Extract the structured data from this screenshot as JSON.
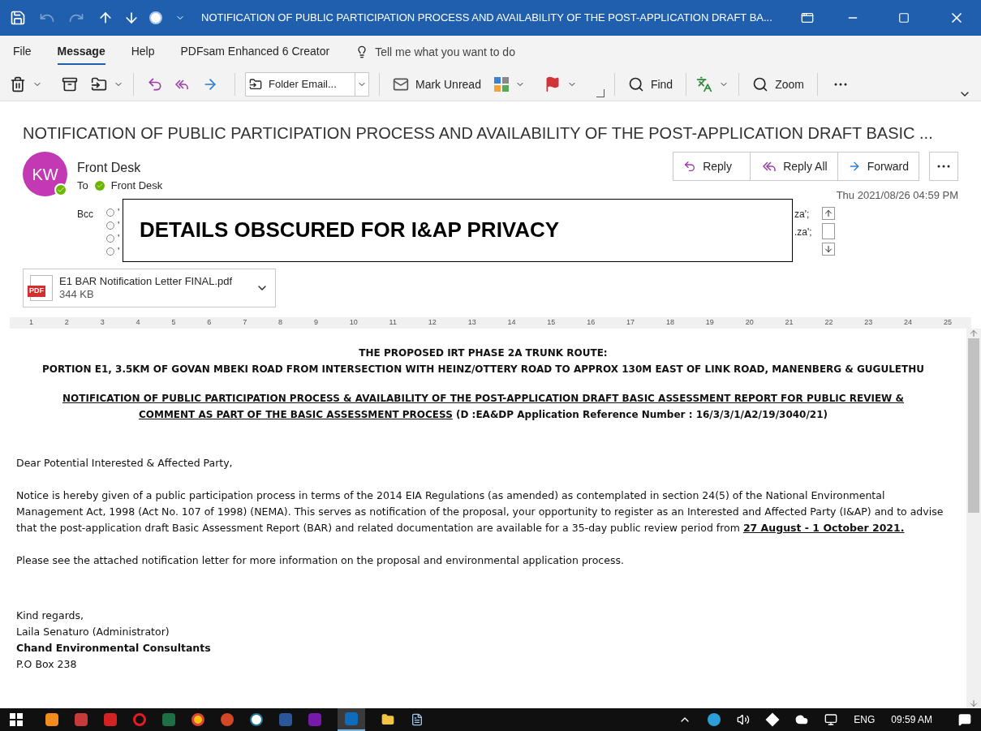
{
  "title_bar": {
    "title": "NOTIFICATION OF PUBLIC PARTICIPATION PROCESS AND AVAILABILITY OF THE POST-APPLICATION DRAFT BA..."
  },
  "menu_tabs": [
    {
      "label": "File",
      "selected": false
    },
    {
      "label": "Message",
      "selected": true
    },
    {
      "label": "Help",
      "selected": false
    },
    {
      "label": "PDFsam Enhanced 6 Creator",
      "selected": false
    }
  ],
  "tell_me": {
    "placeholder": "Tell me what you want to do"
  },
  "toolbar": {
    "folder_dropdown": "Folder Email...",
    "mark_unread": "Mark Unread",
    "find": "Find",
    "zoom": "Zoom"
  },
  "message": {
    "subject": "NOTIFICATION OF PUBLIC PARTICIPATION PROCESS AND AVAILABILITY OF THE POST-APPLICATION DRAFT BASIC ...",
    "avatar_initials": "KW",
    "sender": "Front Desk",
    "to_label": "To",
    "to": "Front Desk",
    "bcc_label": "Bcc",
    "bcc_left": [
      "'",
      "'",
      "'",
      "'"
    ],
    "bcc_right": [
      "za';",
      ".za';"
    ],
    "date": "Thu 2021/08/26 04:59 PM",
    "actions": [
      {
        "kind": "reply",
        "label": "Reply"
      },
      {
        "kind": "reply_all",
        "label": "Reply All"
      },
      {
        "kind": "forward",
        "label": "Forward"
      }
    ],
    "privacy_notice": "DETAILS OBSCURED FOR I&AP PRIVACY",
    "attachment": {
      "name": "E1 BAR Notification Letter FINAL.pdf",
      "size": "344 KB",
      "type_label": "PDF"
    }
  },
  "ruler": [
    "1",
    "2",
    "3",
    "4",
    "5",
    "6",
    "7",
    "8",
    "9",
    "10",
    "11",
    "12",
    "13",
    "14",
    "15",
    "16",
    "17",
    "18",
    "19",
    "20",
    "21",
    "22",
    "23",
    "24",
    "25"
  ],
  "body": {
    "heading_lines": [
      "THE PROPOSED IRT PHASE 2A TRUNK ROUTE:",
      "PORTION E1, 3.5KM OF GOVAN MBEKI ROAD FROM INTERSECTION WITH HEINZ/OTTERY ROAD TO APPROX 130M EAST OF LINK ROAD, MANENBERG & GUGULETHU"
    ],
    "notice_title": "NOTIFICATION OF PUBLIC PARTICIPATION PROCESS & AVAILABILITY OF THE POST-APPLICATION DRAFT BASIC ASSESSMENT REPORT FOR PUBLIC REVIEW & COMMENT AS PART OF THE BASIC ASSESSMENT PROCESS",
    "notice_ref": " (D :EA&DP Application Reference Number : 16/3/3/1/A2/19/3040/21)",
    "paragraphs": [
      "Dear Potential Interested & Affected Party,",
      "Notice is hereby given of a public participation process in terms of the 2014 EIA Regulations (as amended) as contemplated in section 24(5) of the National Environmental Management Act, 1998 (Act No. 107 of 1998) (NEMA). This serves as notification of the proposal, your opportunity to register as an Interested and Affected Party (I&AP) and to advise that the post-application draft Basic Assessment Report (BAR) and related documentation are available for a 35-day public review period from **27 August - 1 October 2021.**",
      "Please see the attached notification letter for more information on the proposal and environmental application process."
    ],
    "signature": [
      {
        "text": "Kind regards,",
        "bold": false
      },
      {
        "text": "Laila Senaturo (Administrator)",
        "bold": false
      },
      {
        "text": "Chand Environmental Consultants",
        "bold": true
      },
      {
        "text": "P.O Box 238",
        "bold": false
      }
    ]
  },
  "taskbar": {
    "language": "ENG",
    "time": "09:59 AM"
  }
}
